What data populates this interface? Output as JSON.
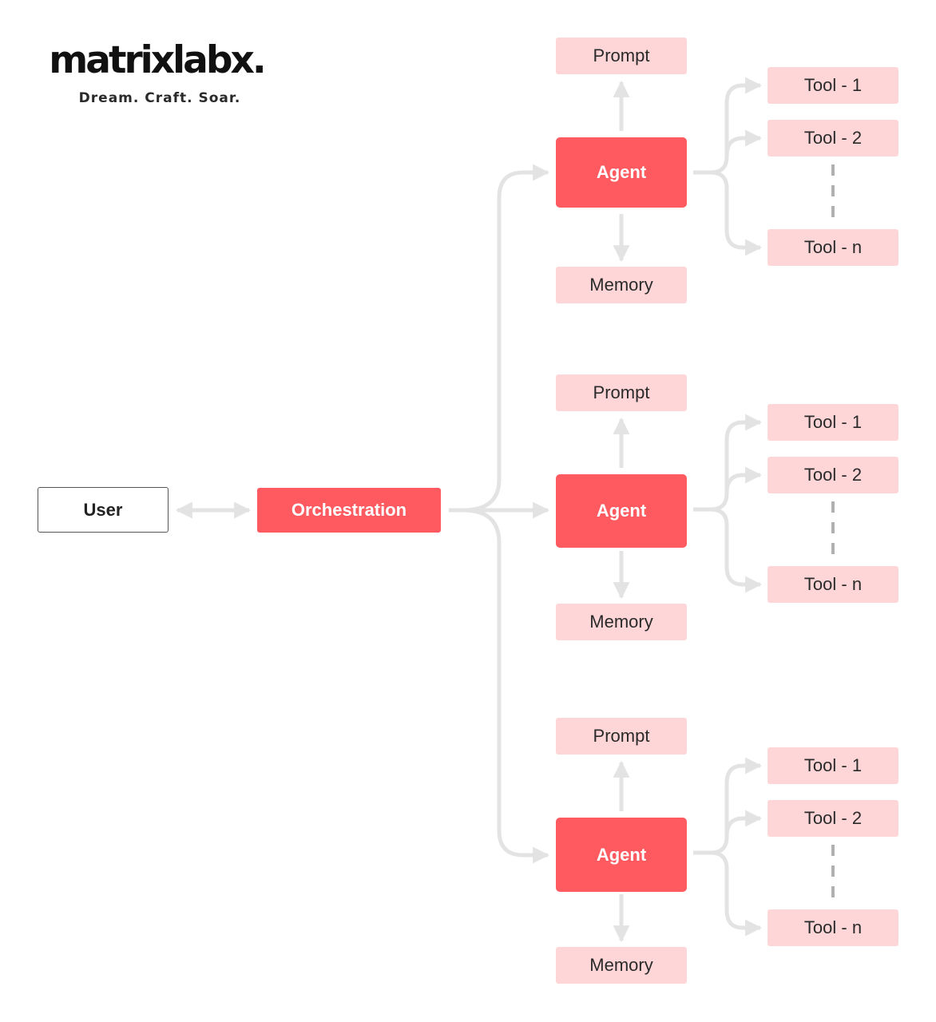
{
  "logo": {
    "brand": "matrixlabx.",
    "tagline": "Dream. Craft. Soar."
  },
  "nodes": {
    "user": "User",
    "orchestration": "Orchestration"
  },
  "agents": [
    {
      "label": "Agent",
      "prompt": "Prompt",
      "memory": "Memory",
      "tools": [
        "Tool - 1",
        "Tool - 2",
        "Tool - n"
      ]
    },
    {
      "label": "Agent",
      "prompt": "Prompt",
      "memory": "Memory",
      "tools": [
        "Tool - 1",
        "Tool - 2",
        "Tool - n"
      ]
    },
    {
      "label": "Agent",
      "prompt": "Prompt",
      "memory": "Memory",
      "tools": [
        "Tool - 1",
        "Tool - 2",
        "Tool - n"
      ]
    }
  ],
  "colors": {
    "primary": "#ff5a5f",
    "secondary": "#ffd6d8",
    "connector": "#e3e3e3",
    "dashed": "#b0b0b0"
  }
}
